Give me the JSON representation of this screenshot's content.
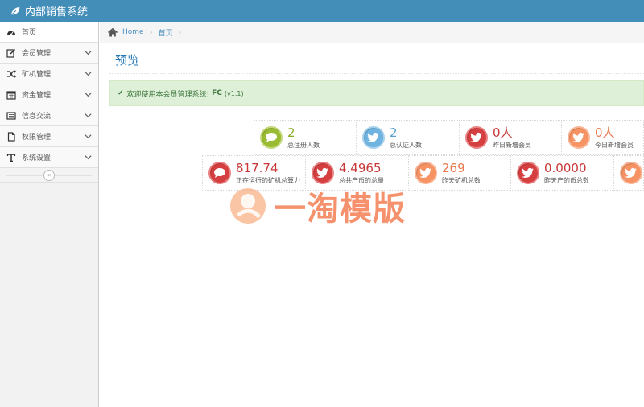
{
  "app": {
    "title": "内部销售系统"
  },
  "sidebar": {
    "items": [
      {
        "label": "首页",
        "icon": "dashboard-icon"
      },
      {
        "label": "会员管理",
        "icon": "edit-icon"
      },
      {
        "label": "矿机管理",
        "icon": "shuffle-icon"
      },
      {
        "label": "资金管理",
        "icon": "calendar-icon"
      },
      {
        "label": "信息交流",
        "icon": "list-icon"
      },
      {
        "label": "权限管理",
        "icon": "file-icon"
      },
      {
        "label": "系统设置",
        "icon": "text-icon"
      }
    ],
    "collapse_label": "«"
  },
  "breadcrumb": {
    "home": "Home",
    "current": "首页"
  },
  "page": {
    "title": "预览"
  },
  "alert": {
    "text": "欢迎使用本会员管理系统!",
    "brand": "FC",
    "version": "(v1.1)"
  },
  "stats_row1": [
    {
      "value": "2",
      "caption": "总注册人数",
      "color": "green",
      "icon": "comments-icon"
    },
    {
      "value": "2",
      "caption": "总认证人数",
      "color": "blue",
      "icon": "twitter-icon"
    },
    {
      "value": "0人",
      "caption": "昨日新增会员",
      "color": "red",
      "icon": "twitter-icon"
    },
    {
      "value": "0人",
      "caption": "今日新增会员",
      "color": "orange",
      "icon": "twitter-icon"
    }
  ],
  "stats_row2": [
    {
      "value": "817.74",
      "caption": "正在运行的矿机总算力",
      "color": "red",
      "icon": "comments-icon"
    },
    {
      "value": "4.4965",
      "caption": "总共产币的总量",
      "color": "red",
      "icon": "twitter-icon"
    },
    {
      "value": "269",
      "caption": "昨天矿机总数",
      "color": "orange",
      "icon": "twitter-icon"
    },
    {
      "value": "0.0000",
      "caption": "昨天产的币总数",
      "color": "red",
      "icon": "twitter-icon"
    },
    {
      "value": "",
      "caption": "",
      "color": "orange",
      "icon": "twitter-icon"
    }
  ],
  "watermark": {
    "text": "一淘模版"
  },
  "colors": {
    "navbar": "#438eb9",
    "green": "#9abc32",
    "blue": "#6fb3e0",
    "red": "#d53f40",
    "orange": "#f79263"
  }
}
